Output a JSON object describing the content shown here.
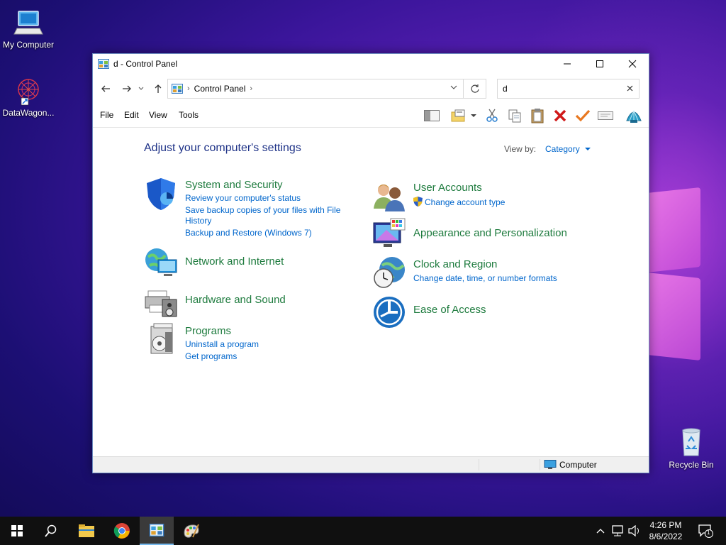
{
  "desktop": {
    "icons": [
      {
        "label": "My Computer"
      },
      {
        "label": "DataWagon..."
      },
      {
        "label": "Recycle Bin"
      }
    ]
  },
  "window": {
    "title": "d - Control Panel",
    "address": {
      "crumb": "Control Panel"
    },
    "search": {
      "value": "d"
    },
    "menu": [
      "File",
      "Edit",
      "View",
      "Tools"
    ],
    "heading": "Adjust your computer's settings",
    "view_by": {
      "label": "View by:",
      "value": "Category"
    },
    "categories_left": [
      {
        "title": "System and Security",
        "links": [
          "Review your computer's status",
          "Save backup copies of your files with File",
          "History",
          "Backup and Restore (Windows 7)"
        ]
      },
      {
        "title": "Network and Internet",
        "links": []
      },
      {
        "title": "Hardware and Sound",
        "links": []
      },
      {
        "title": "Programs",
        "links": [
          "Uninstall a program",
          "Get programs"
        ]
      }
    ],
    "categories_right": [
      {
        "title": "User Accounts",
        "links": [
          "Change account type"
        ]
      },
      {
        "title": "Appearance and Personalization",
        "links": []
      },
      {
        "title": "Clock and Region",
        "links": [
          "Change date, time, or number formats"
        ]
      },
      {
        "title": "Ease of Access",
        "links": []
      }
    ],
    "status": {
      "location": "Computer"
    }
  },
  "taskbar": {
    "clock_time": "4:26 PM",
    "clock_date": "8/6/2022",
    "notification_count": "1"
  }
}
